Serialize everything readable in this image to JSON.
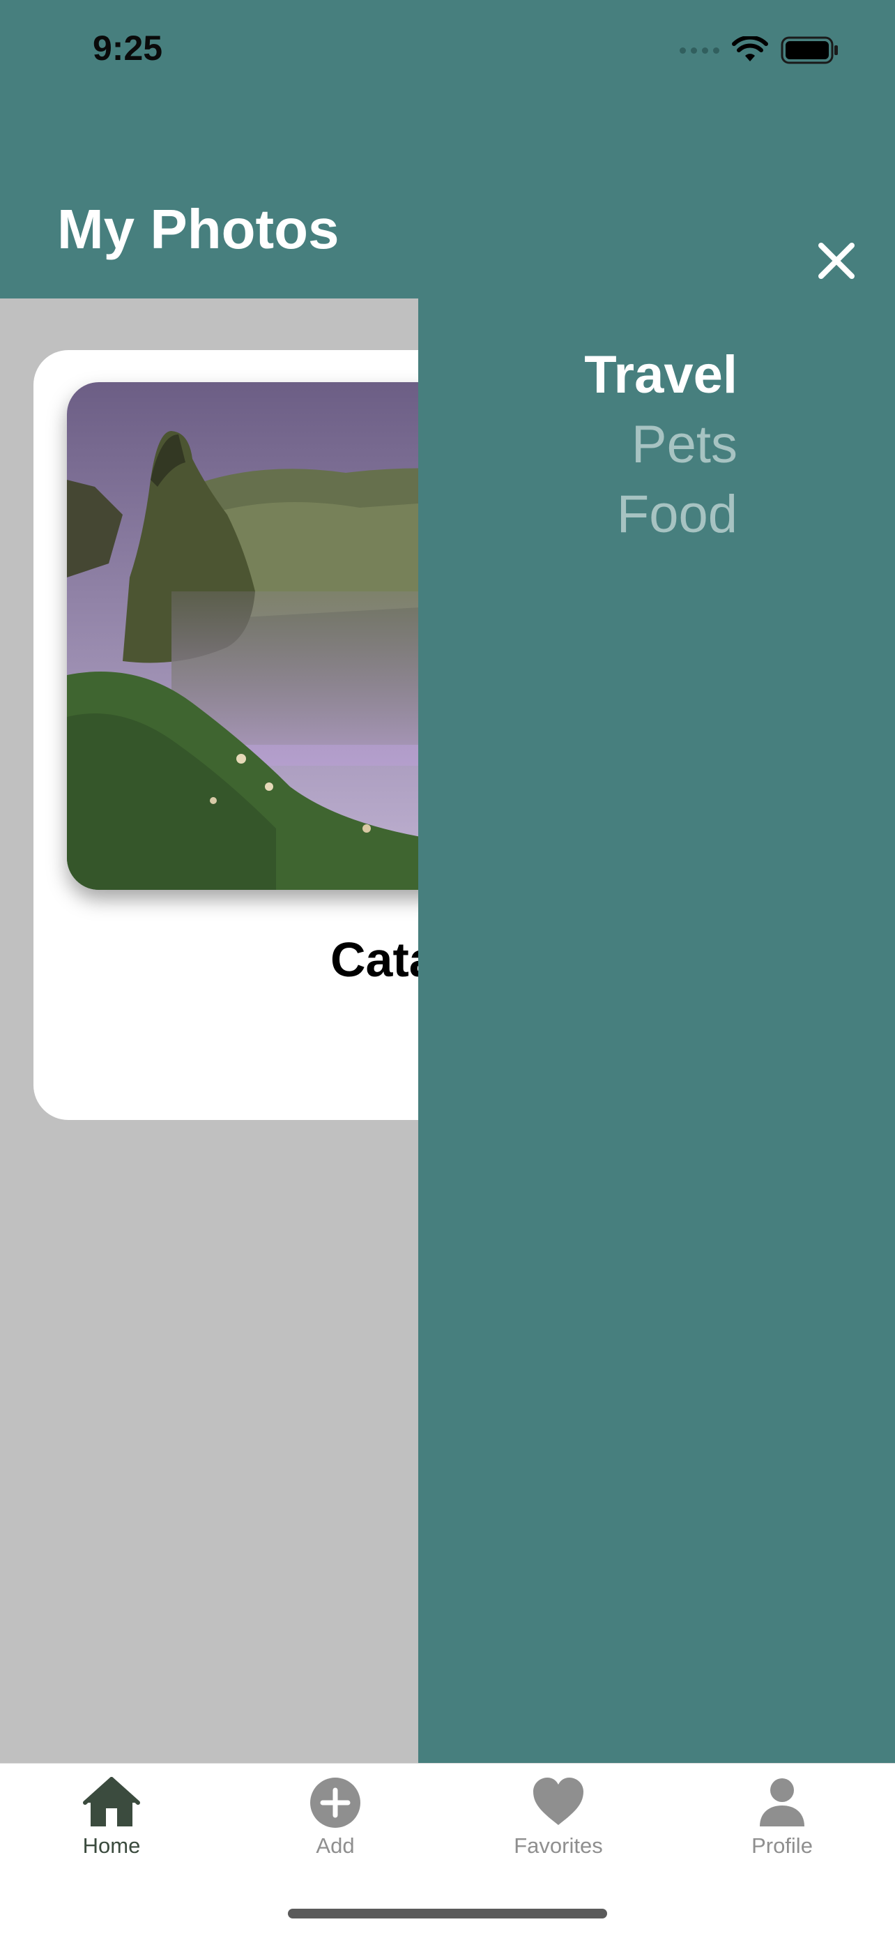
{
  "status_bar": {
    "time": "9:25"
  },
  "header": {
    "title": "My Photos"
  },
  "card": {
    "caption": "Cata"
  },
  "drawer": {
    "items": [
      {
        "label": "Travel",
        "active": true
      },
      {
        "label": "Pets",
        "active": false
      },
      {
        "label": "Food",
        "active": false
      }
    ],
    "close_icon": "close-icon"
  },
  "tabbar": {
    "tabs": [
      {
        "label": "Home",
        "icon": "home-icon",
        "active": true
      },
      {
        "label": "Add",
        "icon": "add-circle-icon",
        "active": false
      },
      {
        "label": "Favorites",
        "icon": "heart-icon",
        "active": false
      },
      {
        "label": "Profile",
        "icon": "person-icon",
        "active": false
      }
    ]
  },
  "colors": {
    "header": "#477f7e",
    "drawer": "#477f7e",
    "content_bg": "#c0c0c0",
    "inactive_menu": "#a7c3c2",
    "home_tab_active": "#3b4b3e",
    "tab_inactive": "#8f8f8f"
  }
}
